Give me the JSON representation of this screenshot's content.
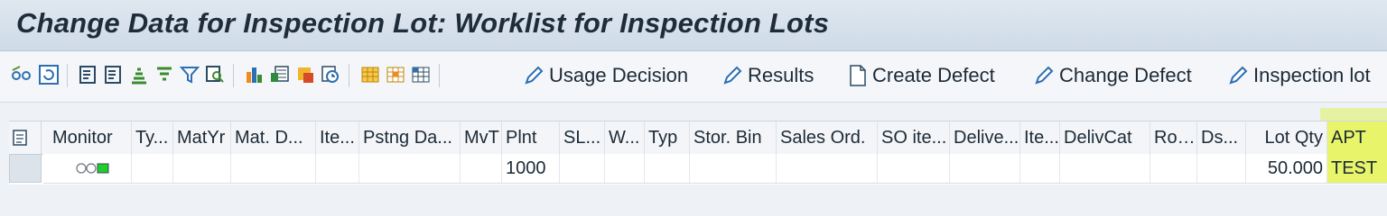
{
  "title": "Change Data for Inspection Lot: Worklist for Inspection Lots",
  "toolbar": {
    "icons": [
      "glasses-icon",
      "refresh-icon",
      "layout-icon",
      "layout-alt-icon",
      "sort-asc-icon",
      "filter-set-icon",
      "filter-icon",
      "find-icon",
      "chart-icon",
      "excel-export-icon",
      "word-icon",
      "clock-icon",
      "grid-icon",
      "grid-edit-icon",
      "grid-select-icon"
    ],
    "buttons": [
      {
        "label": "Usage Decision",
        "icon": "pencil-icon"
      },
      {
        "label": "Results",
        "icon": "pencil-icon"
      },
      {
        "label": "Create Defect",
        "icon": "document-icon"
      },
      {
        "label": "Change Defect",
        "icon": "pencil-icon"
      },
      {
        "label": "Inspection lot",
        "icon": "pencil-icon"
      }
    ]
  },
  "table": {
    "columns": [
      "Monitor",
      "Ty...",
      "MatYr",
      "Mat. D...",
      "Ite...",
      "Pstng Da...",
      "MvT",
      "Plnt",
      "SL...",
      "W...",
      "Typ",
      "Stor. Bin",
      "Sales Ord.",
      "SO ite...",
      "Delive...",
      "Ite...",
      "DelivCat",
      "Route",
      "Ds...",
      "Lot Qty",
      "APT"
    ],
    "rows": [
      {
        "Monitor": "",
        "Plnt": "1000",
        "Lot Qty": "50.000",
        "APT": "TEST"
      }
    ]
  },
  "colors": {
    "highlight": "#dff25c",
    "monitor_green": "#1fcf2d"
  }
}
